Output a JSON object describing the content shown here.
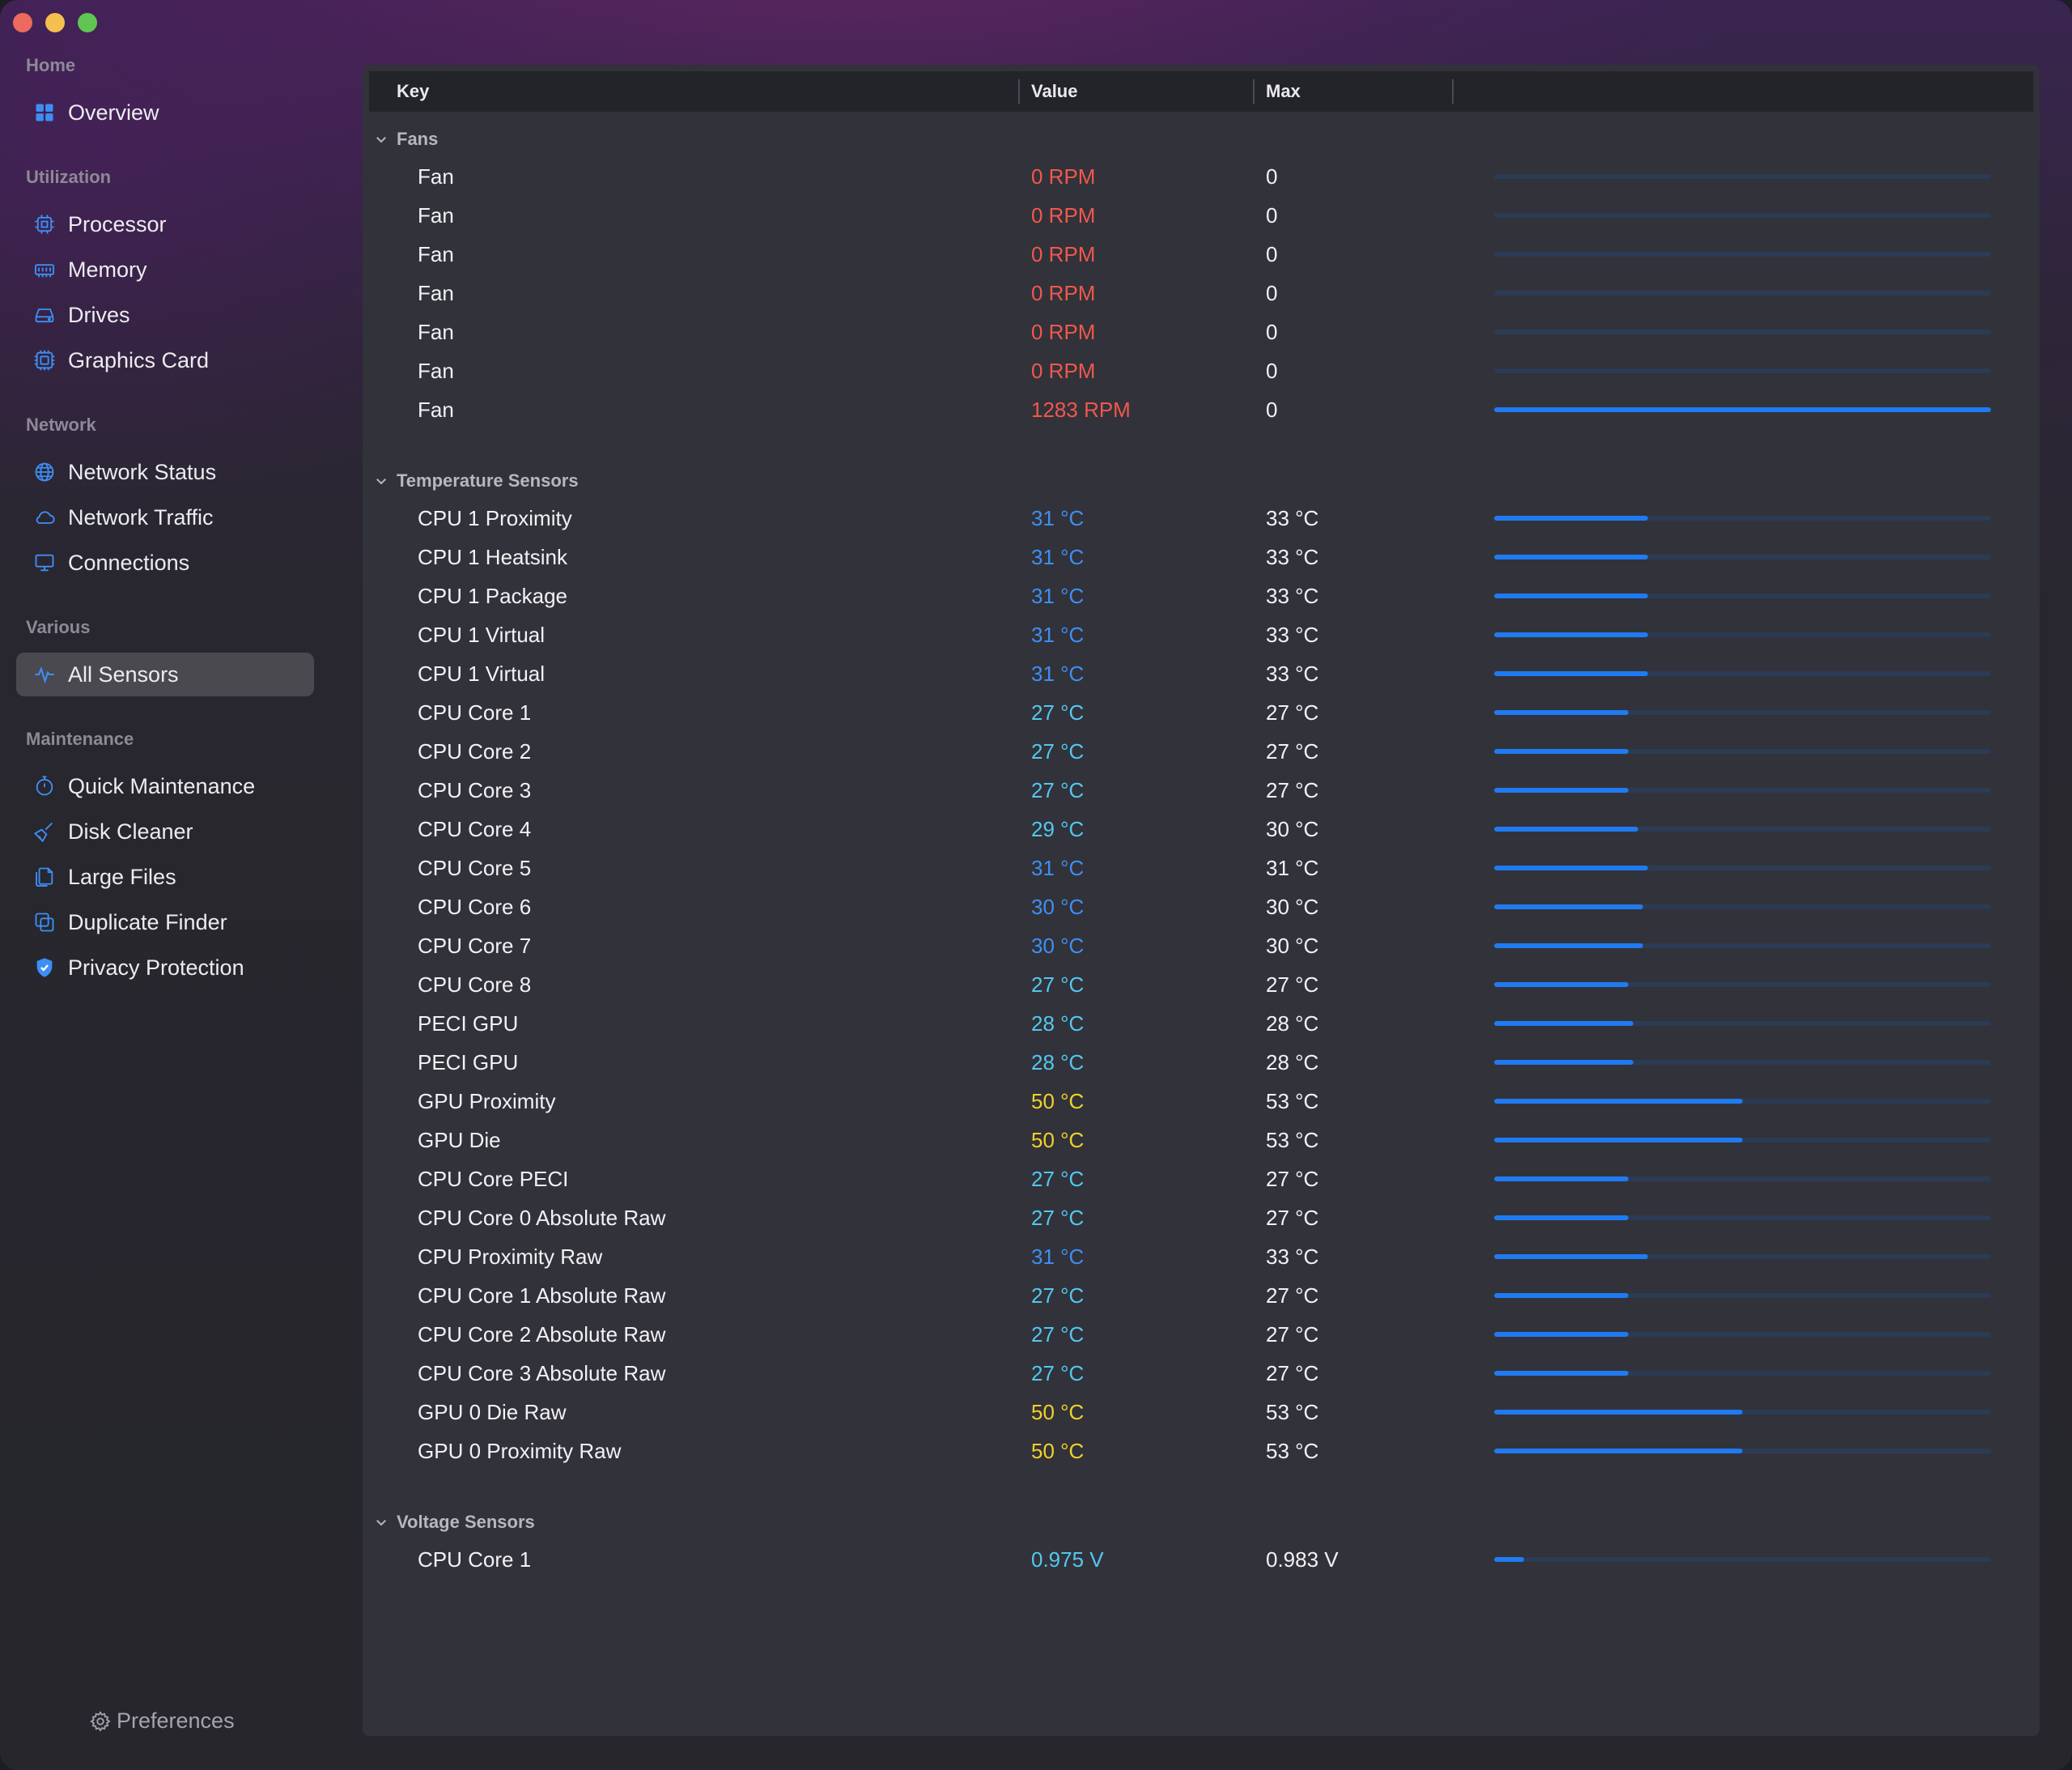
{
  "colors": {
    "red": "#f0584d",
    "blue": "#3d8ff5",
    "cyan": "#52c8f0",
    "yellow": "#f2d128",
    "bar_fill": "#1f7bf2",
    "bar_track": "#2c3b55"
  },
  "sidebar": {
    "sections": [
      {
        "title": "Home",
        "items": [
          {
            "label": "Overview",
            "icon": "grid-icon"
          }
        ]
      },
      {
        "title": "Utilization",
        "items": [
          {
            "label": "Processor",
            "icon": "cpu-icon"
          },
          {
            "label": "Memory",
            "icon": "memory-icon"
          },
          {
            "label": "Drives",
            "icon": "drive-icon"
          },
          {
            "label": "Graphics Card",
            "icon": "gpu-icon"
          }
        ]
      },
      {
        "title": "Network",
        "items": [
          {
            "label": "Network Status",
            "icon": "globe-icon"
          },
          {
            "label": "Network Traffic",
            "icon": "cloud-icon"
          },
          {
            "label": "Connections",
            "icon": "monitor-icon"
          }
        ]
      },
      {
        "title": "Various",
        "items": [
          {
            "label": "All Sensors",
            "icon": "pulse-icon",
            "active": true
          }
        ]
      },
      {
        "title": "Maintenance",
        "items": [
          {
            "label": "Quick Maintenance",
            "icon": "stopwatch-icon"
          },
          {
            "label": "Disk Cleaner",
            "icon": "broom-icon"
          },
          {
            "label": "Large Files",
            "icon": "files-icon"
          },
          {
            "label": "Duplicate Finder",
            "icon": "duplicate-icon"
          },
          {
            "label": "Privacy Protection",
            "icon": "shield-icon"
          }
        ]
      }
    ],
    "preferences_label": "Preferences"
  },
  "table": {
    "columns": {
      "key": "Key",
      "value": "Value",
      "max": "Max"
    },
    "groups": [
      {
        "title": "Fans",
        "rows": [
          {
            "key": "Fan",
            "value": "0 RPM",
            "max": "0",
            "color": "red",
            "level": 0
          },
          {
            "key": "Fan",
            "value": "0 RPM",
            "max": "0",
            "color": "red",
            "level": 0
          },
          {
            "key": "Fan",
            "value": "0 RPM",
            "max": "0",
            "color": "red",
            "level": 0
          },
          {
            "key": "Fan",
            "value": "0 RPM",
            "max": "0",
            "color": "red",
            "level": 0
          },
          {
            "key": "Fan",
            "value": "0 RPM",
            "max": "0",
            "color": "red",
            "level": 0
          },
          {
            "key": "Fan",
            "value": "0 RPM",
            "max": "0",
            "color": "red",
            "level": 0
          },
          {
            "key": "Fan",
            "value": "1283 RPM",
            "max": "0",
            "color": "red",
            "level": 1.0
          }
        ]
      },
      {
        "title": "Temperature Sensors",
        "rows": [
          {
            "key": "CPU 1 Proximity",
            "value": "31 °C",
            "max": "33 °C",
            "color": "blue",
            "level": 0.31
          },
          {
            "key": "CPU 1 Heatsink",
            "value": "31 °C",
            "max": "33 °C",
            "color": "blue",
            "level": 0.31
          },
          {
            "key": "CPU 1 Package",
            "value": "31 °C",
            "max": "33 °C",
            "color": "blue",
            "level": 0.31
          },
          {
            "key": "CPU 1 Virtual",
            "value": "31 °C",
            "max": "33 °C",
            "color": "blue",
            "level": 0.31
          },
          {
            "key": "CPU 1 Virtual",
            "value": "31 °C",
            "max": "33 °C",
            "color": "blue",
            "level": 0.31
          },
          {
            "key": "CPU Core 1",
            "value": "27 °C",
            "max": "27 °C",
            "color": "cyan",
            "level": 0.27
          },
          {
            "key": "CPU Core 2",
            "value": "27 °C",
            "max": "27 °C",
            "color": "cyan",
            "level": 0.27
          },
          {
            "key": "CPU Core 3",
            "value": "27 °C",
            "max": "27 °C",
            "color": "cyan",
            "level": 0.27
          },
          {
            "key": "CPU Core 4",
            "value": "29 °C",
            "max": "30 °C",
            "color": "cyan",
            "level": 0.29
          },
          {
            "key": "CPU Core 5",
            "value": "31 °C",
            "max": "31 °C",
            "color": "blue",
            "level": 0.31
          },
          {
            "key": "CPU Core 6",
            "value": "30 °C",
            "max": "30 °C",
            "color": "blue",
            "level": 0.3
          },
          {
            "key": "CPU Core 7",
            "value": "30 °C",
            "max": "30 °C",
            "color": "blue",
            "level": 0.3
          },
          {
            "key": "CPU Core 8",
            "value": "27 °C",
            "max": "27 °C",
            "color": "cyan",
            "level": 0.27
          },
          {
            "key": "PECI GPU",
            "value": "28 °C",
            "max": "28 °C",
            "color": "cyan",
            "level": 0.28
          },
          {
            "key": "PECI GPU",
            "value": "28 °C",
            "max": "28 °C",
            "color": "cyan",
            "level": 0.28
          },
          {
            "key": "GPU Proximity",
            "value": "50 °C",
            "max": "53 °C",
            "color": "yellow",
            "level": 0.5
          },
          {
            "key": "GPU Die",
            "value": "50 °C",
            "max": "53 °C",
            "color": "yellow",
            "level": 0.5
          },
          {
            "key": "CPU Core PECI",
            "value": "27 °C",
            "max": "27 °C",
            "color": "cyan",
            "level": 0.27
          },
          {
            "key": "CPU Core 0 Absolute Raw",
            "value": "27 °C",
            "max": "27 °C",
            "color": "cyan",
            "level": 0.27
          },
          {
            "key": "CPU Proximity Raw",
            "value": "31 °C",
            "max": "33 °C",
            "color": "blue",
            "level": 0.31
          },
          {
            "key": "CPU Core 1 Absolute Raw",
            "value": "27 °C",
            "max": "27 °C",
            "color": "cyan",
            "level": 0.27
          },
          {
            "key": "CPU Core 2 Absolute Raw",
            "value": "27 °C",
            "max": "27 °C",
            "color": "cyan",
            "level": 0.27
          },
          {
            "key": "CPU Core 3 Absolute Raw",
            "value": "27 °C",
            "max": "27 °C",
            "color": "cyan",
            "level": 0.27
          },
          {
            "key": "GPU 0 Die Raw",
            "value": "50 °C",
            "max": "53 °C",
            "color": "yellow",
            "level": 0.5
          },
          {
            "key": "GPU 0 Proximity Raw",
            "value": "50 °C",
            "max": "53 °C",
            "color": "yellow",
            "level": 0.5
          }
        ]
      },
      {
        "title": "Voltage Sensors",
        "rows": [
          {
            "key": "CPU Core 1",
            "value": "0.975 V",
            "max": "0.983 V",
            "color": "cyan",
            "level": 0.06
          }
        ]
      }
    ]
  }
}
